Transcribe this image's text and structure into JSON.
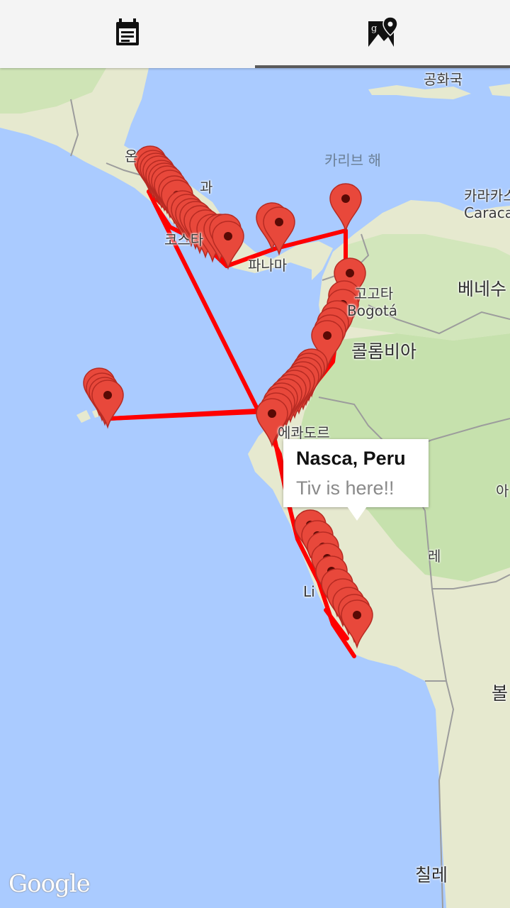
{
  "tabs": [
    {
      "id": "timeline",
      "icon": "notes-calendar-icon",
      "selected": false
    },
    {
      "id": "map",
      "icon": "map-pin-icon",
      "selected": true
    }
  ],
  "colors": {
    "water": "#aacbff",
    "land": "#e8ead0",
    "forest": "#c3dfab",
    "route": "#ff0000",
    "marker": "#e8483b",
    "tab_indicator": "#5a5a5a"
  },
  "map": {
    "labels": {
      "gonghwaguk": "공화국",
      "caribbean": "카리브 해",
      "caracas_ko": "카라카스",
      "caracas": "Caracas",
      "venezuela": "베네수",
      "bogota_ko": "고고타",
      "bogota": "Bogotá",
      "colombia": "콜롬비아",
      "panama": "파나마",
      "costarica": "코스타",
      "ecuador": "에콰도르",
      "lima": "Li",
      "bolivia": "볼",
      "chile": "칠레",
      "guatemala_frag": "온",
      "peru_frag": "레",
      "brazil_frag": "아",
      "nicaragua_frag": "과"
    },
    "popup": {
      "title": "Nasca, Peru",
      "snippet": "Tiv is here!!"
    },
    "attribution": "Google"
  }
}
